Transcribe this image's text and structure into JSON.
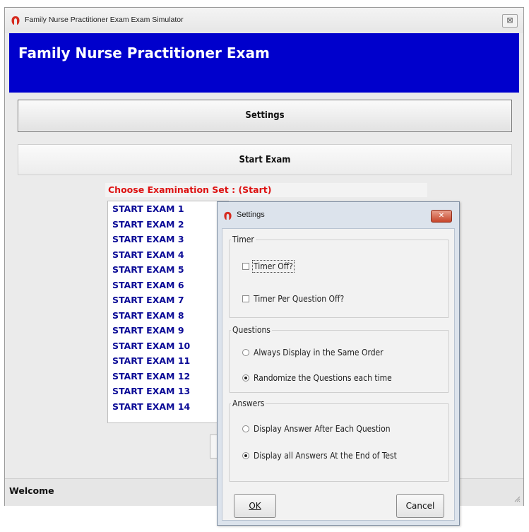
{
  "window": {
    "title": "Family Nurse Practitioner Exam Exam Simulator",
    "close_glyph": "⊠"
  },
  "header": {
    "title": "Family Nurse Practitioner Exam",
    "bg_color": "#0000cc"
  },
  "main": {
    "settings_button": "Settings",
    "start_exam_button": "Start Exam",
    "choose_label": "Choose Examination Set : (Start)",
    "exam_sets": [
      "START EXAM 1",
      "START EXAM 2",
      "START EXAM 3",
      "START EXAM 4",
      "START EXAM 5",
      "START EXAM 6",
      "START EXAM 7",
      "START EXAM 8",
      "START EXAM 9",
      "START EXAM 10",
      "START EXAM 11",
      "START EXAM 12",
      "START EXAM 13",
      "START EXAM 14"
    ]
  },
  "status_bar": {
    "text": "Welcome"
  },
  "settings_dialog": {
    "title": "Settings",
    "close_glyph": "✕",
    "timer": {
      "legend": "Timer",
      "timer_off": {
        "label": "Timer Off?",
        "checked": false
      },
      "timer_per_question_off": {
        "label": "Timer Per Question Off?",
        "checked": false
      }
    },
    "questions": {
      "legend": "Questions",
      "same_order": {
        "label": "Always Display in the Same Order",
        "selected": false
      },
      "randomize": {
        "label": "Randomize the Questions each time",
        "selected": true
      }
    },
    "answers": {
      "legend": "Answers",
      "after_each": {
        "label": "Display Answer After Each Question",
        "selected": false
      },
      "at_end": {
        "label": "Display all Answers At the End of Test",
        "selected": true
      }
    },
    "ok_button": "OK",
    "cancel_button": "Cancel"
  },
  "colors": {
    "choose_label": "#dd1111",
    "exam_item": "#0a0a96",
    "dialog_frame": "#dce3ec"
  },
  "icons": [
    "app-icon",
    "close-icon",
    "resize-grip-icon"
  ]
}
